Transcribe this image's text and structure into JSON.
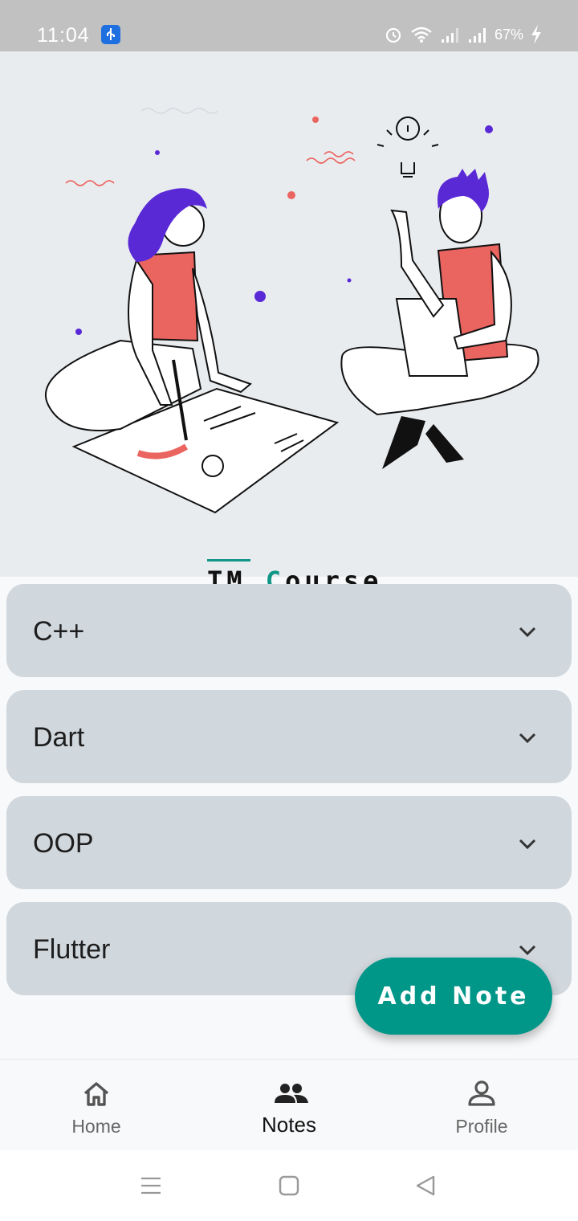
{
  "status_bar": {
    "time": "11:04",
    "battery": "67%",
    "icons": [
      "usb-icon",
      "alarm-icon",
      "wifi-icon",
      "signal-icon",
      "signal-icon",
      "charging-icon"
    ]
  },
  "hero": {
    "logo_prefix": "TM ",
    "logo_accent": "C",
    "logo_suffix": "ourse"
  },
  "courses": [
    {
      "label": "C++"
    },
    {
      "label": "Dart"
    },
    {
      "label": "OOP"
    },
    {
      "label": "Flutter"
    }
  ],
  "fab": {
    "label": "Add Note"
  },
  "bottom_nav": {
    "items": [
      {
        "label": "Home",
        "icon": "home-icon"
      },
      {
        "label": "Notes",
        "icon": "people-icon",
        "active": true
      },
      {
        "label": "Profile",
        "icon": "person-icon"
      }
    ]
  },
  "colors": {
    "accent": "#009688",
    "card": "#d0d7dd",
    "hero_bg": "#e9ecef",
    "figure_red": "#eb6560",
    "figure_purple": "#5a29d6"
  }
}
